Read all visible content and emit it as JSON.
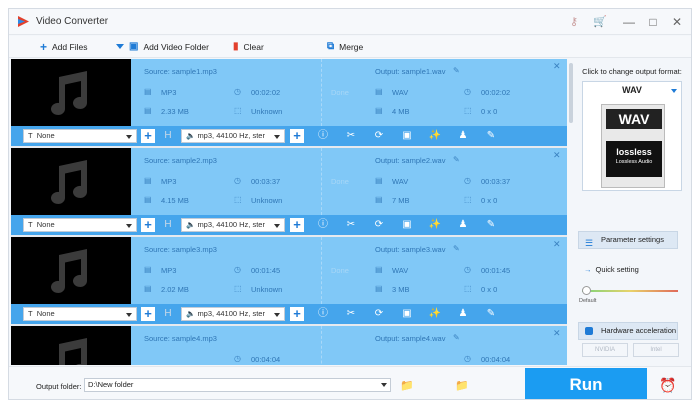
{
  "app": {
    "title": "Video Converter"
  },
  "toolbar": {
    "add_files": "Add Files",
    "add_video_folder": "Add Video Folder",
    "clear": "Clear",
    "merge": "Merge"
  },
  "items": [
    {
      "source": "Source: sample1.mp3",
      "src_format": "MP3",
      "src_duration": "00:02:02",
      "src_size": "2.33 MB",
      "src_resolution": "Unknown",
      "status": "Done",
      "output": "Output: sample1.wav",
      "out_format": "WAV",
      "out_duration": "00:02:02",
      "out_size": "4 MB",
      "out_resolution": "0 x 0",
      "subtitle": "None",
      "audio": "mp3, 44100 Hz, ster"
    },
    {
      "source": "Source: sample2.mp3",
      "src_format": "MP3",
      "src_duration": "00:03:37",
      "src_size": "4.15 MB",
      "src_resolution": "Unknown",
      "status": "Done",
      "output": "Output: sample2.wav",
      "out_format": "WAV",
      "out_duration": "00:03:37",
      "out_size": "7 MB",
      "out_resolution": "0 x 0",
      "subtitle": "None",
      "audio": "mp3, 44100 Hz, ster"
    },
    {
      "source": "Source: sample3.mp3",
      "src_format": "MP3",
      "src_duration": "00:01:45",
      "src_size": "2.02 MB",
      "src_resolution": "Unknown",
      "status": "Done",
      "output": "Output: sample3.wav",
      "out_format": "WAV",
      "out_duration": "00:01:45",
      "out_size": "3 MB",
      "out_resolution": "0 x 0",
      "subtitle": "None",
      "audio": "mp3, 44100 Hz, ster"
    },
    {
      "source": "Source: sample4.mp3",
      "src_duration": "00:04:04",
      "output": "Output: sample4.wav",
      "out_duration": "00:04:04"
    }
  ],
  "right_panel": {
    "label": "Click to change output format:",
    "format": "WAV",
    "art_title": "WAV",
    "art_logo": "lossless",
    "art_sub": "Lossless Audio",
    "parameter_settings": "Parameter settings",
    "quick_setting": "Quick setting",
    "slider_default": "Default",
    "hardware_acceleration": "Hardware acceleration",
    "gpu_nvidia": "NVIDIA",
    "gpu_intel": "Intel"
  },
  "bottom": {
    "output_folder_label": "Output folder:",
    "output_folder_path": "D:\\New folder",
    "run": "Run"
  }
}
